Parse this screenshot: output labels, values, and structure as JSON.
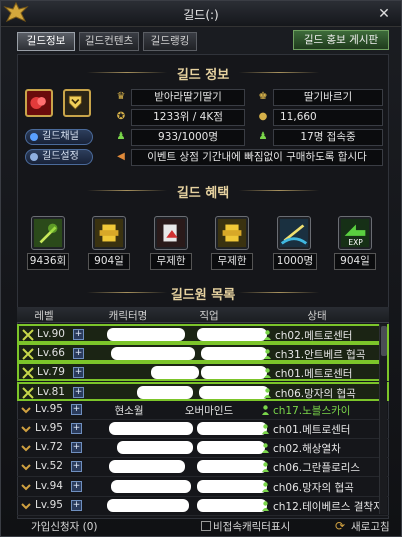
{
  "window": {
    "title": "길드(:)"
  },
  "tabs": [
    {
      "label": "길드정보",
      "active": true
    },
    {
      "label": "길드컨텐츠",
      "active": false
    },
    {
      "label": "길드랭킹",
      "active": false
    }
  ],
  "promo_button": "길드 홍보 게시판",
  "info": {
    "heading": "길드 정보",
    "channel_button": "길드채널",
    "settings_button": "길드설정",
    "guild_name": "받아라딸기딸기",
    "master_name": "딸기바르기",
    "rank": "1233위 / 4K점",
    "points": "11,660",
    "members": "933/1000명",
    "online": "17명 접속중",
    "notice": "이벤트 상점 기간내에 빠짐없이 구매하도록 합시다"
  },
  "benefits": {
    "heading": "길드 혜택",
    "items": [
      {
        "icon": "sword-buff-icon",
        "value": "9436회"
      },
      {
        "icon": "gold-knight-icon",
        "value": "904일"
      },
      {
        "icon": "potion-chart-icon",
        "value": "무제한"
      },
      {
        "icon": "gold-knight-icon",
        "value": "무제한"
      },
      {
        "icon": "ocean-sword-icon",
        "value": "1000명"
      },
      {
        "icon": "exp-arrow-icon",
        "value": "904일"
      }
    ]
  },
  "members": {
    "heading": "길드원 목록",
    "columns": [
      "레벨",
      "캐릭터명",
      "직업",
      "상태"
    ],
    "rows": [
      {
        "level": "Lv.90",
        "name": "",
        "job": "",
        "status": "ch02.메트로센터",
        "online": true,
        "highlight": true
      },
      {
        "level": "Lv.66",
        "name": "",
        "job": "",
        "status": "ch31.안트베르 협곡",
        "online": true,
        "highlight": true
      },
      {
        "level": "Lv.79",
        "name": "",
        "job": "",
        "status": "ch01.메트로센터",
        "online": true,
        "highlight": true
      },
      {
        "level": "Lv.81",
        "name": "",
        "job": "",
        "status": "ch06.망자의 협곡",
        "online": true,
        "highlight": true
      },
      {
        "level": "Lv.95",
        "name": "현소월",
        "job": "오버마인드",
        "status": "ch17.노블스카이",
        "online": true,
        "highlight": false,
        "green": true
      },
      {
        "level": "Lv.95",
        "name": "",
        "job": "",
        "status": "ch01.메트로센터",
        "online": true,
        "highlight": false
      },
      {
        "level": "Lv.72",
        "name": "",
        "job": "",
        "status": "ch02.해상열차",
        "online": true,
        "highlight": false
      },
      {
        "level": "Lv.52",
        "name": "",
        "job": "",
        "status": "ch06.그란플로리스",
        "online": true,
        "highlight": false
      },
      {
        "level": "Lv.94",
        "name": "",
        "job": "",
        "status": "ch06.망자의 협곡",
        "online": true,
        "highlight": false
      },
      {
        "level": "Lv.95",
        "name": "",
        "job": "",
        "status": "ch12.테이베르스 결착지",
        "online": true,
        "highlight": false
      }
    ]
  },
  "footer": {
    "applicants": "가입신청자 (0)",
    "hide_offline": "비접속캐릭터표시",
    "refresh": "새로고침"
  },
  "colors": {
    "highlight": "#7cc52a",
    "accent": "#e6d2a0",
    "online": "#7ad64a"
  }
}
